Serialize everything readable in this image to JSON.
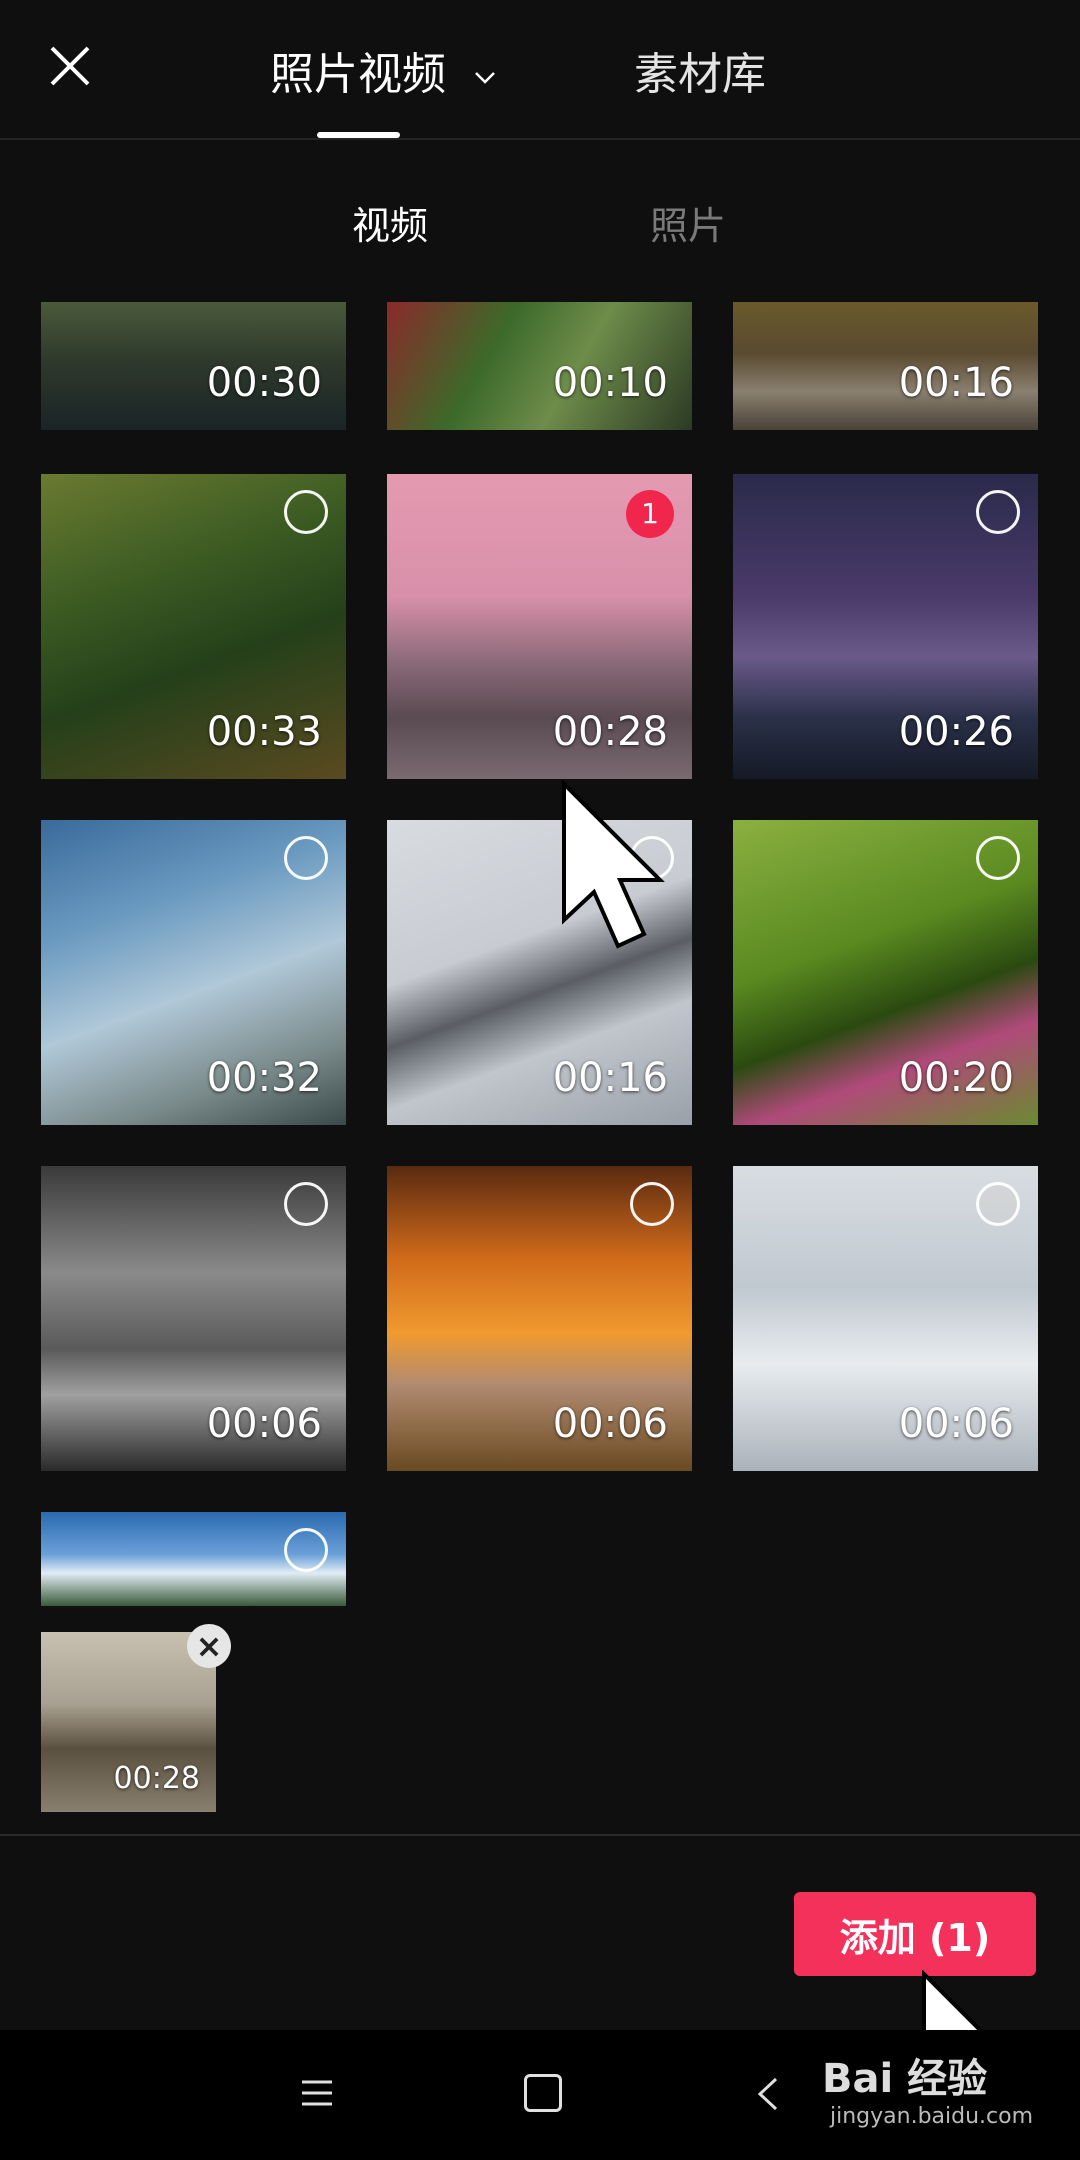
{
  "header": {
    "tab_main": "照片视频",
    "tab_library": "素材库"
  },
  "subtabs": {
    "video": "视频",
    "photo": "照片"
  },
  "grid": {
    "tiles": [
      {
        "duration": "00:30"
      },
      {
        "duration": "00:10"
      },
      {
        "duration": "00:16"
      },
      {
        "duration": "00:33"
      },
      {
        "duration": "00:28",
        "selected_index": "1"
      },
      {
        "duration": "00:26"
      },
      {
        "duration": "00:32"
      },
      {
        "duration": "00:16"
      },
      {
        "duration": "00:20"
      },
      {
        "duration": "00:06"
      },
      {
        "duration": "00:06"
      },
      {
        "duration": "00:06"
      }
    ]
  },
  "selected_tray": {
    "duration": "00:28"
  },
  "footer": {
    "add_label": "添加 (1)"
  },
  "watermark": {
    "brand": "Bai 经验",
    "url": "jingyan.baidu.com"
  },
  "colors": {
    "accent": "#f4315a",
    "badge": "#f0264d",
    "background": "#0f0f10"
  }
}
